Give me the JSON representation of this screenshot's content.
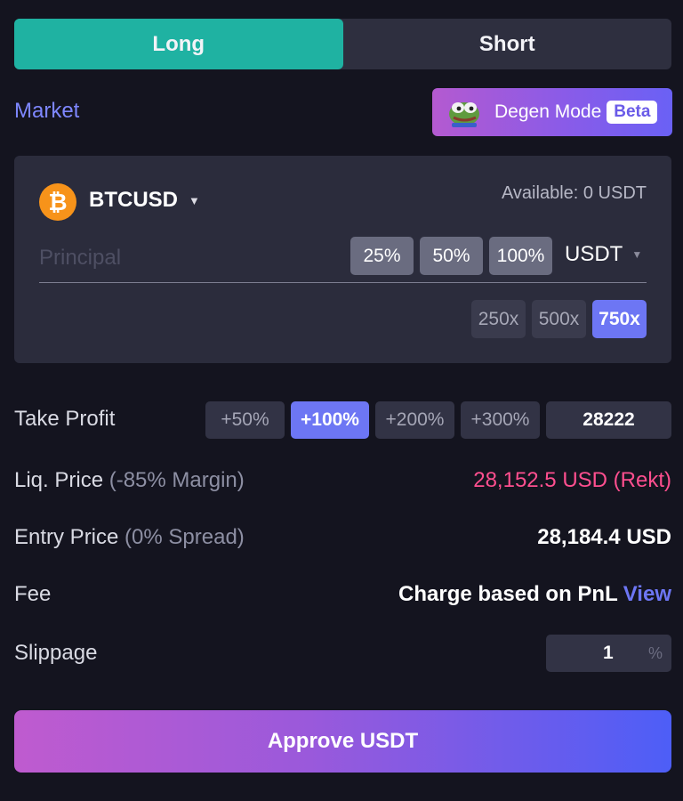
{
  "side_toggle": {
    "long": "Long",
    "short": "Short",
    "active": "Long"
  },
  "order_type": "Market",
  "degen_mode": {
    "label": "Degen Mode",
    "badge": "Beta",
    "icon": "pepe-frog-icon"
  },
  "position": {
    "coin_icon": "bitcoin-icon",
    "pair": "BTCUSD",
    "available": "Available: 0 USDT",
    "principal_placeholder": "Principal",
    "percent_buttons": [
      "25%",
      "50%",
      "100%"
    ],
    "currency": "USDT",
    "leverage_options": [
      "250x",
      "500x",
      "750x"
    ],
    "selected_leverage": "750x"
  },
  "take_profit": {
    "label": "Take Profit",
    "options": [
      "+50%",
      "+100%",
      "+200%",
      "+300%"
    ],
    "selected": "+100%",
    "value": "28222"
  },
  "liq_price": {
    "label": "Liq. Price",
    "sub": "(-85% Margin)",
    "value": "28,152.5 USD (Rekt)"
  },
  "entry_price": {
    "label": "Entry Price",
    "sub": "(0% Spread)",
    "value": "28,184.4 USD"
  },
  "fee": {
    "label": "Fee",
    "value": "Charge based on PnL",
    "link": "View"
  },
  "slippage": {
    "label": "Slippage",
    "value": "1",
    "unit": "%"
  },
  "approve_button": "Approve USDT",
  "colors": {
    "background": "#14141f",
    "long_active": "#1fb2a2",
    "accent": "#6d76f4",
    "rekt": "#ff4f8f",
    "bitcoin": "#f7931a"
  }
}
